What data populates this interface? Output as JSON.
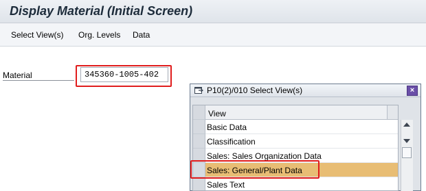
{
  "window": {
    "title": "Display Material (Initial Screen)"
  },
  "menu": {
    "items": [
      {
        "label": "Select View(s)"
      },
      {
        "label": "Org. Levels"
      },
      {
        "label": "Data"
      }
    ]
  },
  "form": {
    "material_label": "Material",
    "material_value": "345360-1005-402"
  },
  "dialog": {
    "title": "P10(2)/010 Select View(s)",
    "close_label": "×",
    "column_header": "View",
    "views": [
      {
        "label": "Basic Data",
        "selected": false
      },
      {
        "label": "Classification",
        "selected": false
      },
      {
        "label": "Sales: Sales Organization Data",
        "selected": false
      },
      {
        "label": "Sales: General/Plant Data",
        "selected": true
      },
      {
        "label": "Sales Text",
        "selected": false
      }
    ]
  },
  "colors": {
    "selected_row": "#e8bd74",
    "highlight_box": "#e01c1c",
    "close_button": "#6a4fa8"
  }
}
